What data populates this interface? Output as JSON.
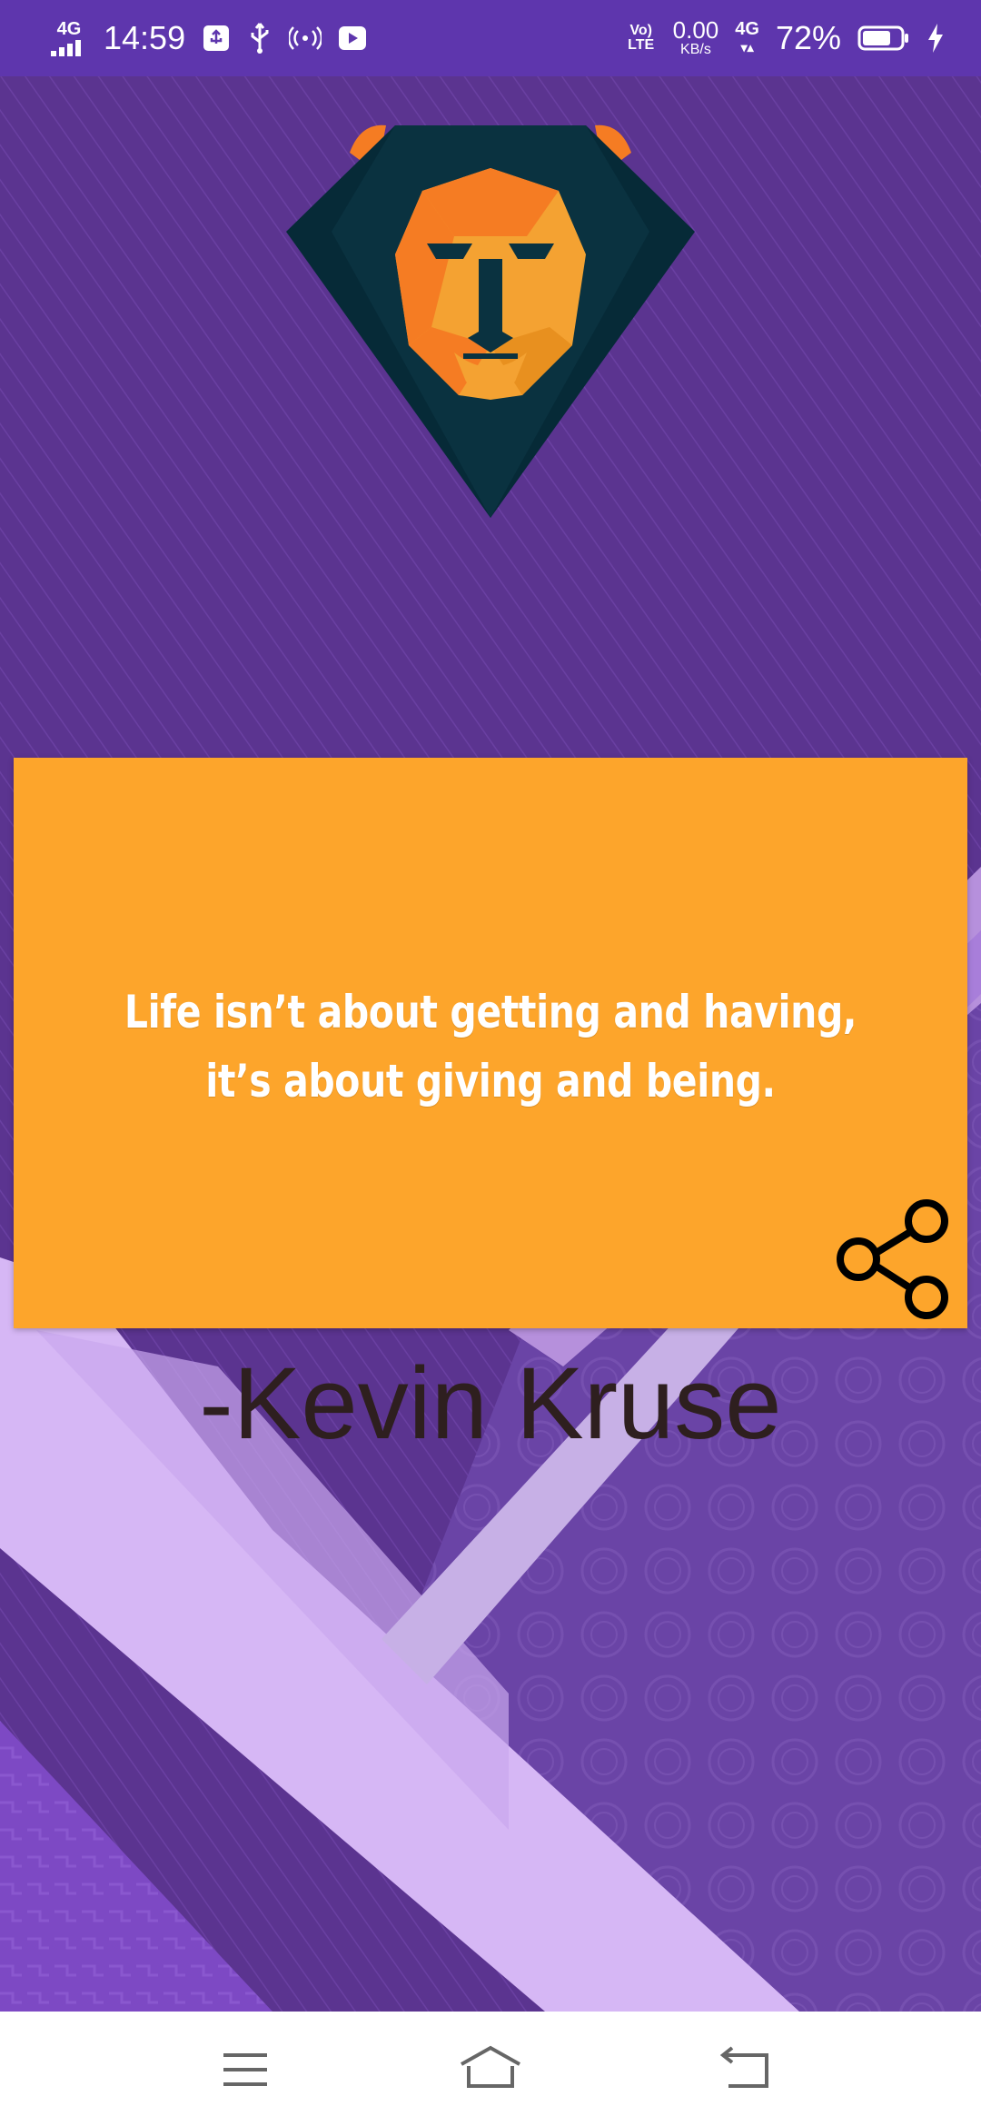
{
  "status_bar": {
    "network_left": "4G",
    "time": "14:59",
    "volte": "Vo) LTE",
    "speed_value": "0.00",
    "speed_unit": "KB/s",
    "network_right": "4G",
    "battery_percent": "72%",
    "icons": [
      "signal-icon",
      "usb-debug-icon",
      "usb-icon",
      "hotspot-icon",
      "youtube-icon",
      "battery-icon",
      "charging-icon"
    ]
  },
  "quote": {
    "text": "Life isn’t about getting and having, it’s about giving and being.",
    "author": "-Kevin Kruse"
  },
  "colors": {
    "status_bar": "#5e36ad",
    "card": "#fda52b",
    "background": "#5b3490",
    "author_text": "#2e1f1f"
  },
  "navigation": {
    "icons": [
      "menu-icon",
      "home-icon",
      "back-icon"
    ]
  }
}
